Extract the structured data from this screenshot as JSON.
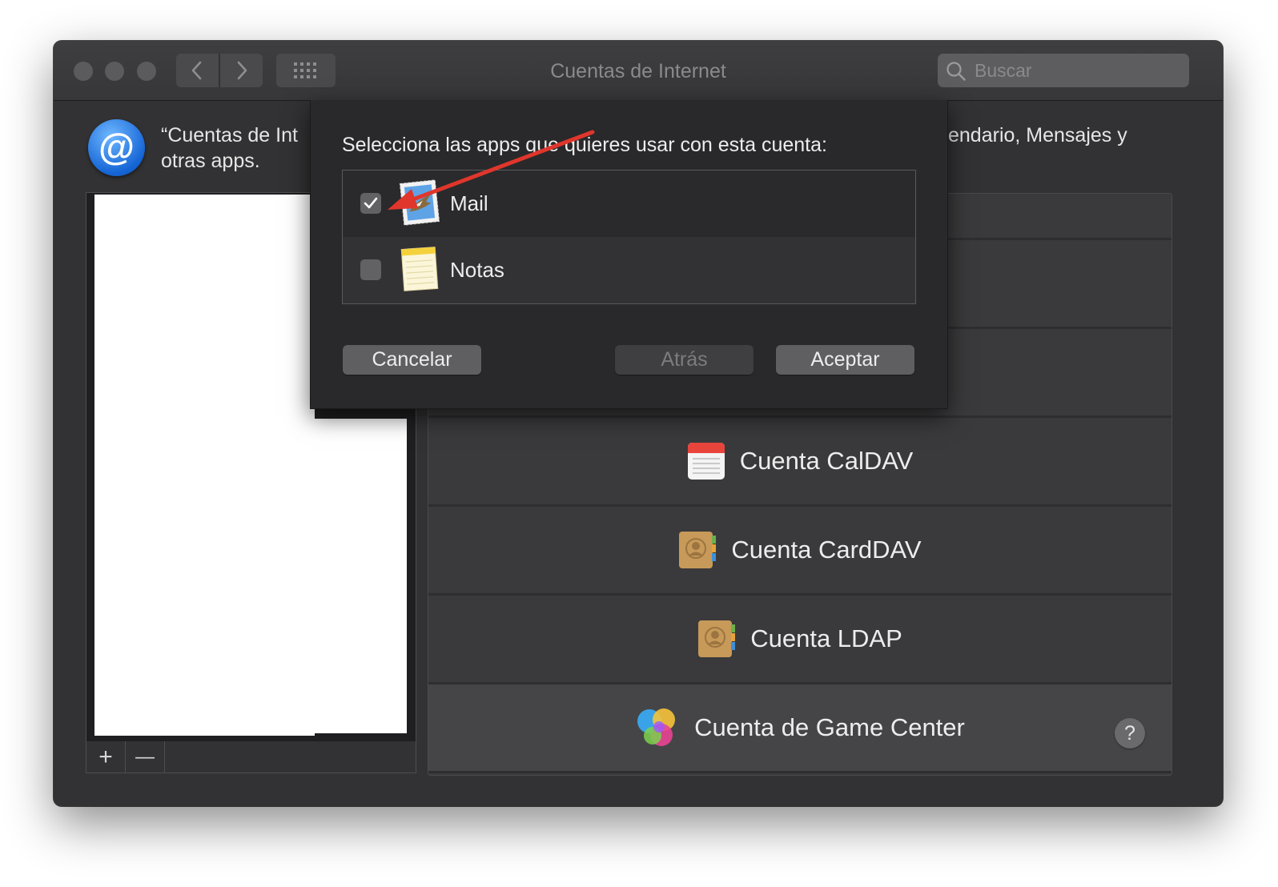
{
  "window": {
    "title": "Cuentas de Internet",
    "search_placeholder": "Buscar",
    "icons": [
      "close-light",
      "minimize-light",
      "zoom-light",
      "chevron-left-icon",
      "chevron-right-icon",
      "grid-icon",
      "search-icon"
    ]
  },
  "header": {
    "icon": "at-sign-icon",
    "icon_glyph": "@",
    "line1_left": "“Cuentas de Int",
    "line1_right": "endario, Mensajes y",
    "line2": "otras apps."
  },
  "accounts_footer": {
    "add": "+",
    "remove": "—"
  },
  "providers": [
    {
      "label": "Cuenta CalDAV",
      "icon": "calendar-icon"
    },
    {
      "label": "Cuenta CardDAV",
      "icon": "contacts-icon"
    },
    {
      "label": "Cuenta LDAP",
      "icon": "contacts-icon"
    },
    {
      "label": "Cuenta de Game Center",
      "icon": "game-center-icon"
    }
  ],
  "help": "?",
  "sheet": {
    "prompt": "Selecciona las apps que quieres usar con esta cuenta:",
    "apps": [
      {
        "label": "Mail",
        "checked": true,
        "icon": "mail-stamp-icon"
      },
      {
        "label": "Notas",
        "checked": false,
        "icon": "notes-icon"
      }
    ],
    "cancel": "Cancelar",
    "back": "Atrás",
    "accept": "Aceptar"
  },
  "colors": {
    "annotation_arrow": "#e0362b",
    "window_bg": "#323234",
    "sheet_bg": "#29292b"
  }
}
